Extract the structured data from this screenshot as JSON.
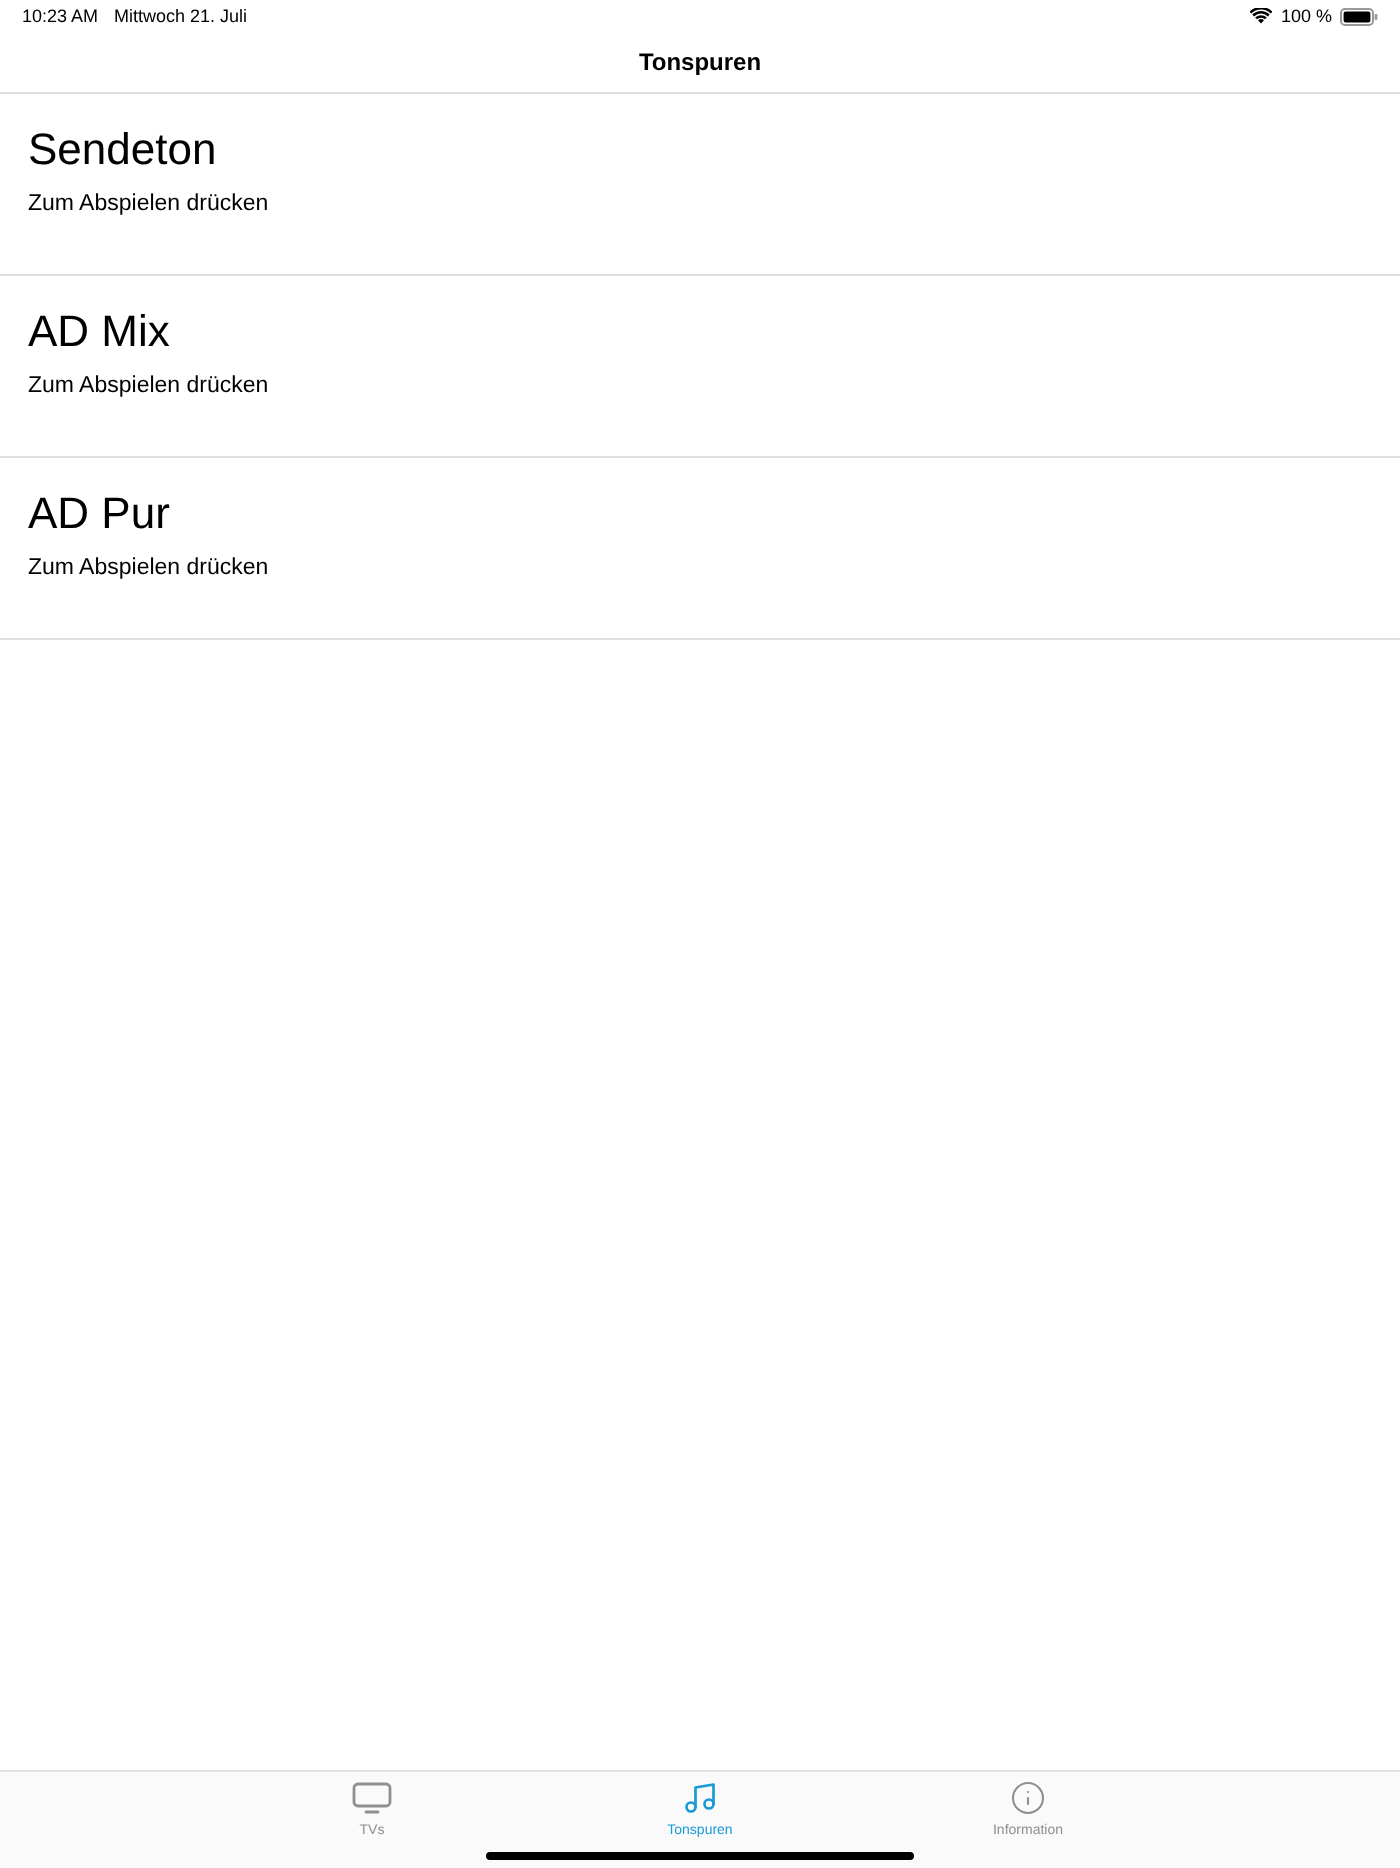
{
  "status_bar": {
    "time": "10:23 AM",
    "date": "Mittwoch 21. Juli",
    "battery": "100 %"
  },
  "nav_bar": {
    "title": "Tonspuren"
  },
  "tracks": [
    {
      "title": "Sendeton",
      "subtitle": "Zum Abspielen drücken"
    },
    {
      "title": "AD Mix",
      "subtitle": "Zum Abspielen drücken"
    },
    {
      "title": "AD Pur",
      "subtitle": "Zum Abspielen drücken"
    }
  ],
  "tab_bar": {
    "tabs": [
      {
        "label": "TVs",
        "kind": "tv",
        "selected": false
      },
      {
        "label": "Tonspuren",
        "kind": "music",
        "selected": true
      },
      {
        "label": "Information",
        "kind": "info",
        "selected": false
      }
    ]
  }
}
